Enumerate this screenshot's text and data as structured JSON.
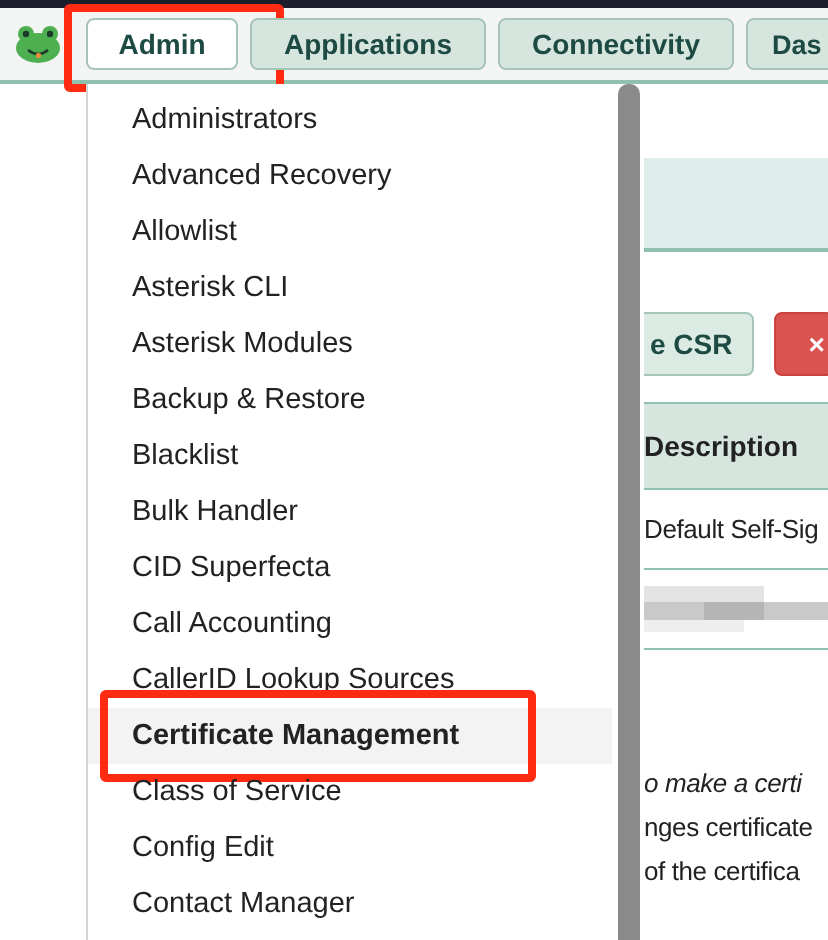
{
  "nav": {
    "tabs": [
      {
        "label": "Admin",
        "selected": true,
        "highlighted": true
      },
      {
        "label": "Applications",
        "selected": false,
        "highlighted": false
      },
      {
        "label": "Connectivity",
        "selected": false,
        "highlighted": false
      },
      {
        "label": "Das",
        "selected": false,
        "highlighted": false
      }
    ]
  },
  "menu": {
    "items": [
      {
        "label": "Administrators",
        "selected": false,
        "highlighted": false
      },
      {
        "label": "Advanced Recovery",
        "selected": false,
        "highlighted": false
      },
      {
        "label": "Allowlist",
        "selected": false,
        "highlighted": false
      },
      {
        "label": "Asterisk CLI",
        "selected": false,
        "highlighted": false
      },
      {
        "label": "Asterisk Modules",
        "selected": false,
        "highlighted": false
      },
      {
        "label": "Backup & Restore",
        "selected": false,
        "highlighted": false
      },
      {
        "label": "Blacklist",
        "selected": false,
        "highlighted": false
      },
      {
        "label": "Bulk Handler",
        "selected": false,
        "highlighted": false
      },
      {
        "label": "CID Superfecta",
        "selected": false,
        "highlighted": false
      },
      {
        "label": "Call Accounting",
        "selected": false,
        "highlighted": false
      },
      {
        "label": "CallerID Lookup Sources",
        "selected": false,
        "highlighted": false
      },
      {
        "label": "Certificate Management",
        "selected": true,
        "highlighted": true
      },
      {
        "label": "Class of Service",
        "selected": false,
        "highlighted": false
      },
      {
        "label": "Config Edit",
        "selected": false,
        "highlighted": false
      },
      {
        "label": "Contact Manager",
        "selected": false,
        "highlighted": false
      }
    ]
  },
  "page": {
    "buttons": [
      {
        "label": "e CSR",
        "kind": "default"
      },
      {
        "label": "×",
        "kind": "danger"
      }
    ],
    "table": {
      "columns": [
        "Description"
      ],
      "rows": [
        [
          "Default Self-Sig"
        ]
      ]
    },
    "notes": [
      {
        "text": "o make a certi",
        "italic": true
      },
      {
        "text": "nges certificate",
        "italic": false
      },
      {
        "text": " of the certifica",
        "italic": false
      }
    ]
  }
}
